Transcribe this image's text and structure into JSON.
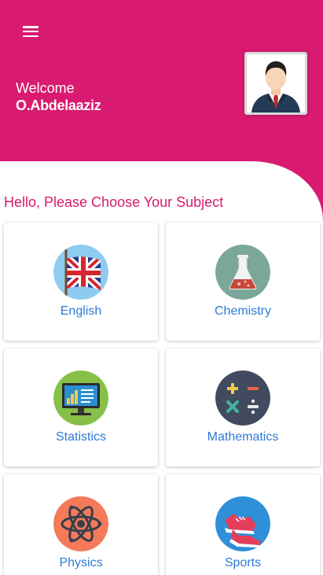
{
  "header": {
    "welcome": "Welcome",
    "username": "O.Abdelaaziz"
  },
  "prompt": "Hello, Please Choose Your Subject",
  "subjects": [
    {
      "label": "English",
      "icon": "uk-flag-icon"
    },
    {
      "label": "Chemistry",
      "icon": "flask-icon"
    },
    {
      "label": "Statistics",
      "icon": "monitor-chart-icon"
    },
    {
      "label": "Mathematics",
      "icon": "math-operators-icon"
    },
    {
      "label": "Physics",
      "icon": "atom-icon"
    },
    {
      "label": "Sports",
      "icon": "sneakers-icon"
    }
  ],
  "colors": {
    "brand": "#d81b70",
    "label": "#2e7bd6",
    "background": "#ffffff"
  }
}
